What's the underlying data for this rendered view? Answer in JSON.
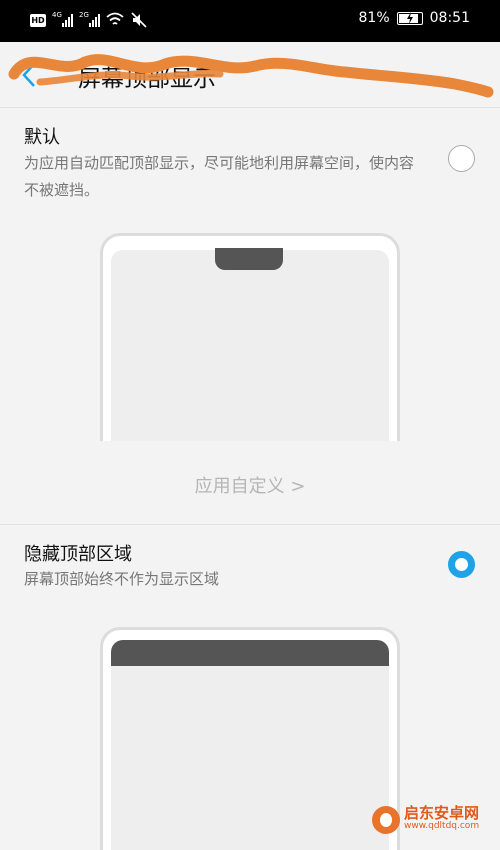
{
  "status_bar": {
    "hd": "HD",
    "sim1_tag": "4G",
    "sim2_tag": "2G",
    "battery_percent": "81%",
    "time": "08:51",
    "battery_level": 0.81,
    "icons": [
      "hd-icon",
      "signal-icon",
      "signal-icon",
      "wifi-icon",
      "mute-icon",
      "battery-icon"
    ]
  },
  "header": {
    "title": "屏幕顶部显示",
    "back_icon": "chevron-left-icon",
    "annotation_color": "#e8863a"
  },
  "options": [
    {
      "title": "默认",
      "description": "为应用自动匹配顶部显示，尽可能地利用屏幕空间，使内容不被遮挡。",
      "selected": false,
      "preview": "notch"
    },
    {
      "title": "隐藏顶部区域",
      "description": "屏幕顶部始终不作为显示区域",
      "selected": true,
      "preview": "top-bar"
    }
  ],
  "custom_link": "应用自定义 >",
  "watermark": {
    "name": "启东安卓网",
    "url": "www.qdltdq.com"
  },
  "colors": {
    "accent": "#1fa3e8",
    "annotation": "#e8863a",
    "background": "#f3f3f3"
  }
}
